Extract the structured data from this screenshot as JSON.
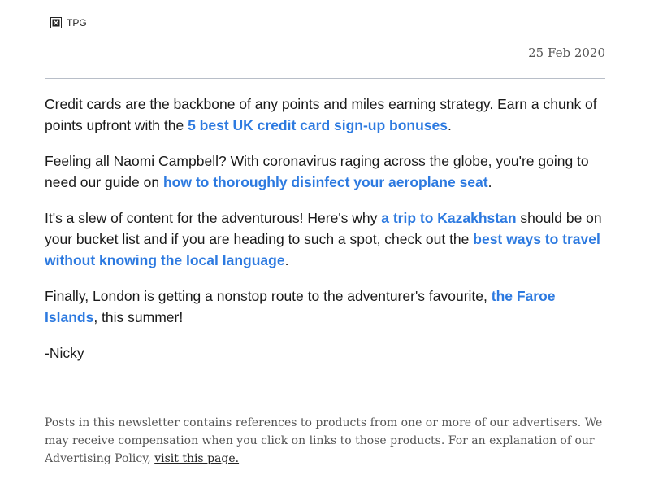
{
  "header": {
    "logo_alt": "TPG",
    "logo_icon": "broken-image-icon",
    "date": "25 Feb 2020"
  },
  "colors": {
    "link": "#2d7ae0",
    "text": "#1a1a1a",
    "muted": "#555555",
    "divider": "#b8bec8"
  },
  "body": {
    "p1": {
      "text_before": "Credit cards are the backbone of any points and miles earning strategy. Earn a chunk of points upfront with the ",
      "link": "5 best UK credit card sign-up bonuses",
      "text_after": "."
    },
    "p2": {
      "text_before": "Feeling all Naomi Campbell? With coronavirus raging across the globe, you're going to need our guide on ",
      "link": "how to thoroughly disinfect your aeroplane seat",
      "text_after": "."
    },
    "p3": {
      "text_before": "It's a slew of content for the adventurous! Here's why ",
      "link1": "a trip to Kazakhstan",
      "text_middle": " should be on your bucket list and if you are heading to such a spot, check out the ",
      "link2": "best ways to travel without knowing the local language",
      "text_after": "."
    },
    "p4": {
      "text_before": "Finally, London is getting a nonstop route to the adventurer's favourite, ",
      "link": "the Faroe Islands",
      "text_after": ", this summer!"
    },
    "signature": "-Nicky"
  },
  "footer": {
    "text": "Posts in this newsletter contains references to products from one or more of our advertisers. We may receive compensation when you click on links to those products. For an explanation of our Advertising Policy, ",
    "link": "visit this page."
  }
}
